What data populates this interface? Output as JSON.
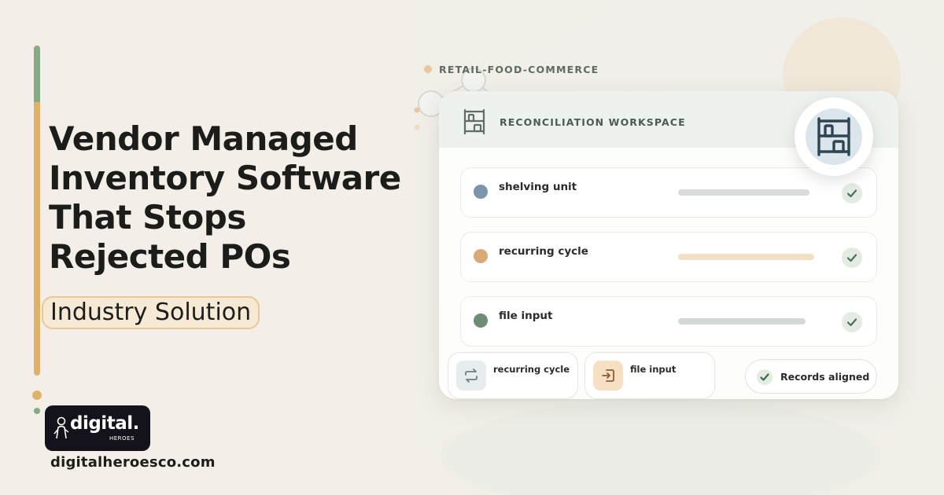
{
  "colors": {
    "background": "#f3efe8",
    "accent_gold": "#ddb36b",
    "accent_green": "#86ab88",
    "dark": "#1c1c1a",
    "navy_icon": "#2f4553"
  },
  "headline": {
    "lines": [
      "Vendor Managed",
      "Inventory Software",
      "That Stops",
      "Rejected POs"
    ]
  },
  "category_pill": "Industry Solution",
  "brand": {
    "logo_word": "digital.",
    "logo_sub": "HEROES",
    "url": "digitalheroesco.com"
  },
  "tag": "RETAIL-FOOD-COMMERCE",
  "workspace": {
    "title": "RECONCILIATION WORKSPACE",
    "header_icon": "shelving-icon",
    "badge_icon": "shelving-icon",
    "rows": [
      {
        "label": "shelving unit",
        "bullet_color": "#7c95ad",
        "bar_color": "#d7dbd9",
        "bar_fill": 0.8,
        "status": "check"
      },
      {
        "label": "recurring cycle",
        "bullet_color": "#dba877",
        "bar_color": "#f3dfc6",
        "bar_fill": 0.83,
        "status": "check"
      },
      {
        "label": "file input",
        "bullet_color": "#6f8c75",
        "bar_color": "#d5d9d5",
        "bar_fill": 0.78,
        "status": "check"
      }
    ],
    "tiles": [
      {
        "label": "recurring cycle",
        "icon": "refresh-icon",
        "icon_bg": "#e7ecee"
      },
      {
        "label": "file input",
        "icon": "file-import-icon",
        "icon_bg": "#f7dfc4"
      }
    ],
    "status": "Records aligned"
  }
}
